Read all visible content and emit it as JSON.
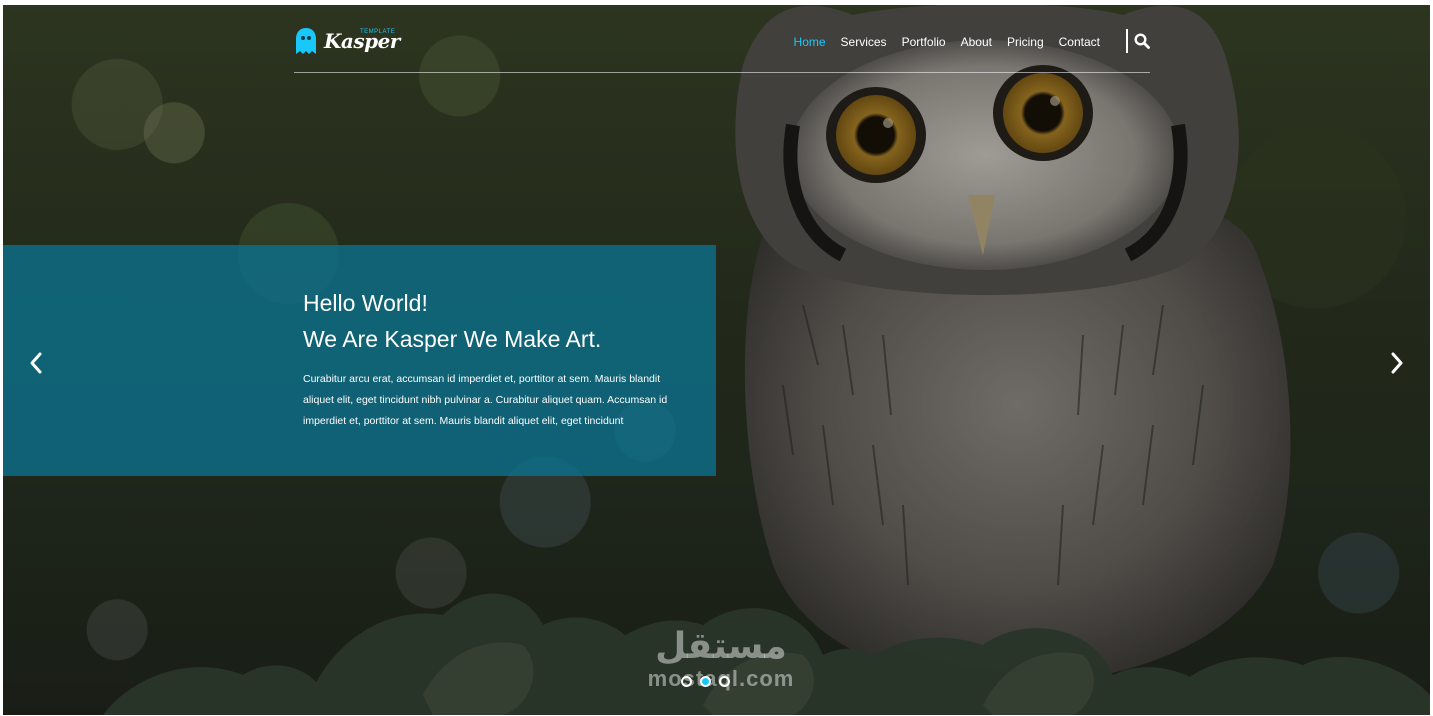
{
  "brand": {
    "name": "Kasper",
    "tagline": "TEMPLATE",
    "accent_color": "#19c8fa",
    "logo_icon": "ghost-icon"
  },
  "nav": {
    "items": [
      {
        "label": "Home",
        "active": true
      },
      {
        "label": "Services",
        "active": false
      },
      {
        "label": "Portfolio",
        "active": false
      },
      {
        "label": "About",
        "active": false
      },
      {
        "label": "Pricing",
        "active": false
      },
      {
        "label": "Contact",
        "active": false
      }
    ],
    "search_icon": "search-icon"
  },
  "hero": {
    "title_line1": "Hello World!",
    "title_line2": "We Are Kasper We Make Art.",
    "body": "Curabitur arcu erat, accumsan id imperdiet et, porttitor at sem. Mauris blandit aliquet elit, eget tincidunt nibh pulvinar a. Curabitur aliquet quam. Accumsan id imperdiet et, porttitor at sem. Mauris blandit aliquet elit, eget tincidunt",
    "caption_color": "#0c708c",
    "prev_icon": "chevron-left-icon",
    "next_icon": "chevron-right-icon"
  },
  "slider": {
    "total_slides": 3,
    "active_slide": 2
  },
  "watermark": {
    "arabic": "مستقل",
    "latin": "mostaql.com"
  }
}
